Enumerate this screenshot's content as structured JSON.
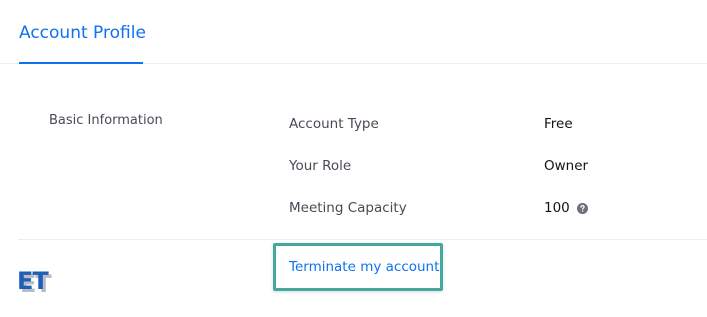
{
  "tabs": {
    "active_label": "Account Profile"
  },
  "basic_info": {
    "section_label": "Basic Information",
    "rows": [
      {
        "label": "Account Type",
        "value": "Free"
      },
      {
        "label": "Your Role",
        "value": "Owner"
      },
      {
        "label": "Meeting Capacity",
        "value": "100",
        "help_icon": "question-circle-icon"
      }
    ]
  },
  "actions": {
    "terminate_label": "Terminate my account"
  },
  "watermark": {
    "text": "ET"
  },
  "colors": {
    "accent": "#0e72ed",
    "highlight": "#45a89c",
    "logo": "#1f5fb5"
  }
}
